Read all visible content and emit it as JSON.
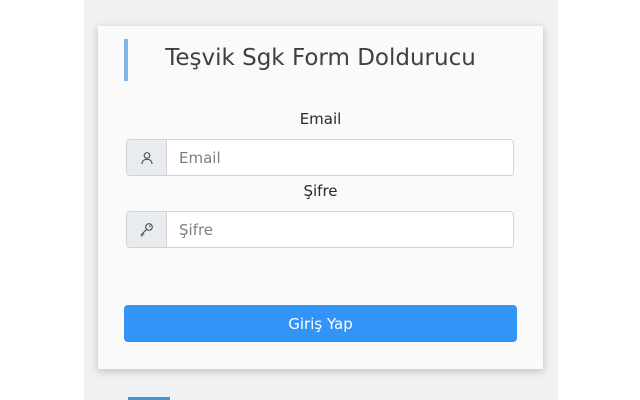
{
  "form": {
    "title": "Teşvik Sgk Form Doldurucu",
    "email_label": "Email",
    "email_placeholder": "Email",
    "email_icon": "user-icon",
    "password_label": "Şifre",
    "password_placeholder": "Şifre",
    "password_icon": "key-icon",
    "submit_label": "Giriş Yap"
  },
  "colors": {
    "accent": "#3294f6",
    "title_bar": "#7eb6ea",
    "backdrop": "#f0f1f3"
  }
}
